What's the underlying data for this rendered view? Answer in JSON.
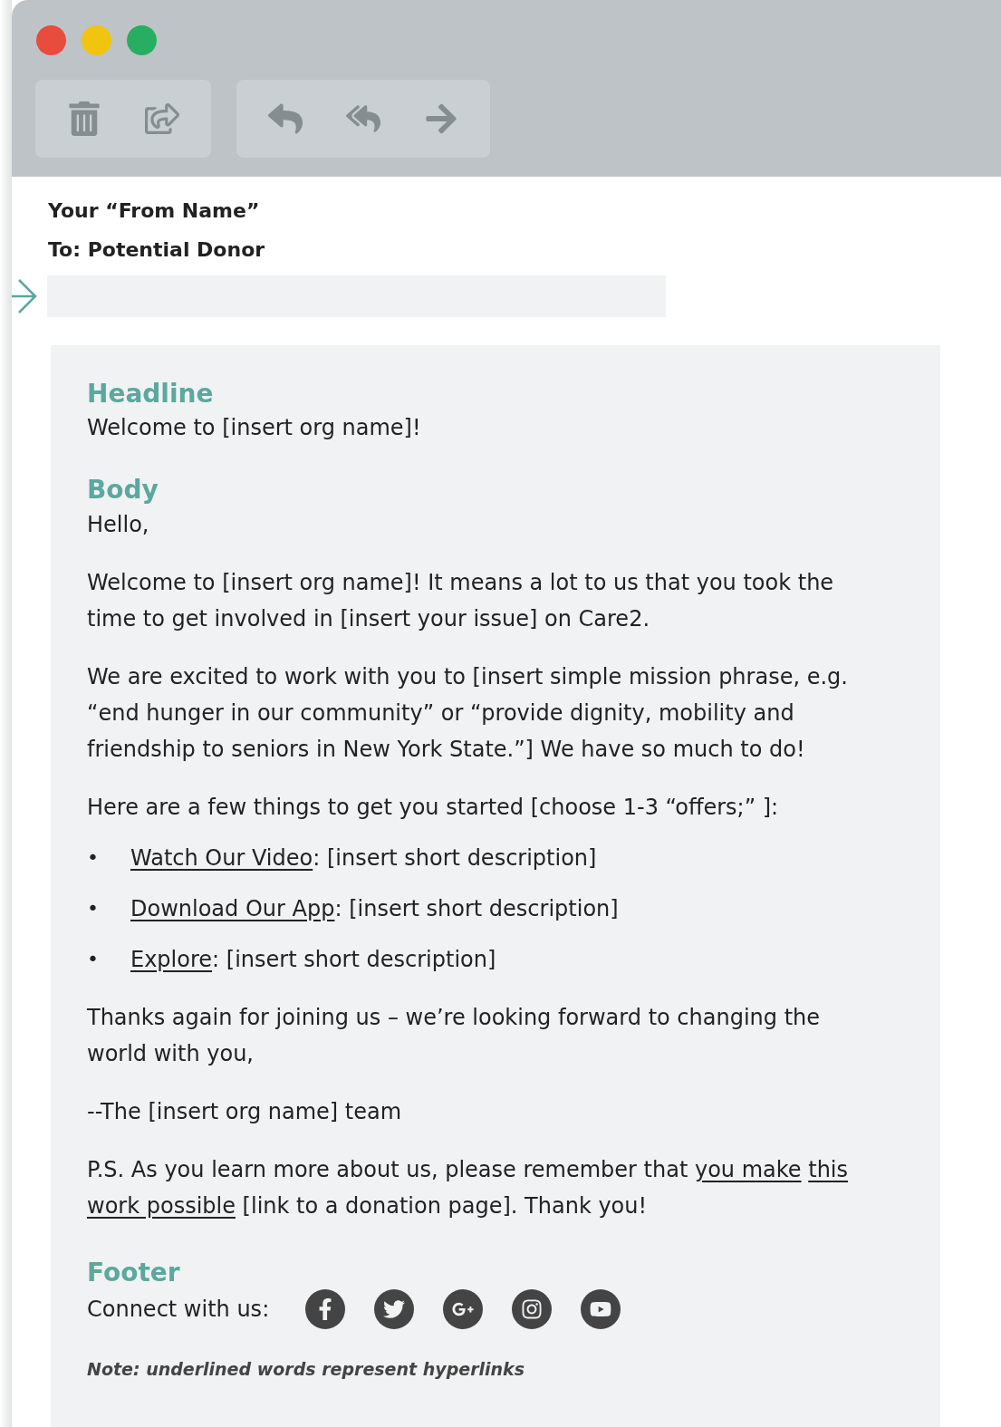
{
  "toolbar": {
    "groups": [
      {
        "buttons": [
          {
            "kind": "trash"
          },
          {
            "kind": "share"
          }
        ]
      },
      {
        "buttons": [
          {
            "kind": "reply"
          },
          {
            "kind": "reply_all"
          },
          {
            "kind": "forward"
          }
        ]
      }
    ]
  },
  "header": {
    "from": "Your “From Name”",
    "to": "To: Potential Donor"
  },
  "headline": {
    "label": "Headline",
    "text": "Welcome to [insert org name]!"
  },
  "body": {
    "label": "Body",
    "blocks": [
      {
        "kind": "paragraph",
        "segments": [
          {
            "text": "Hello,",
            "link": false
          }
        ]
      },
      {
        "kind": "paragraph",
        "segments": [
          {
            "text": "Welcome to [insert org name]! It means a lot to us that you took the time to get involved in [insert your issue] on Care2.",
            "link": false
          }
        ]
      },
      {
        "kind": "paragraph",
        "segments": [
          {
            "text": "We are excited to work with you to [insert simple mission phrase, e.g. “end hunger in our community” or “provide dignity, mobility and friendship to seniors in New York State.”] We have so much to do!",
            "link": false
          }
        ]
      },
      {
        "kind": "paragraph",
        "segments": [
          {
            "text": "Here are a few things to get you started [choose 1-3 “offers;” ]:",
            "link": false
          }
        ]
      },
      {
        "kind": "bullets",
        "bullet": "•",
        "items": [
          {
            "segments": [
              {
                "text": "Watch Our Video",
                "link": true
              },
              {
                "text": ": [insert short description]",
                "link": false
              }
            ]
          },
          {
            "segments": [
              {
                "text": "Download Our App",
                "link": true
              },
              {
                "text": ": [insert short description]",
                "link": false
              }
            ]
          },
          {
            "segments": [
              {
                "text": "Explore",
                "link": true
              },
              {
                "text": ": [insert short description]",
                "link": false
              }
            ]
          }
        ]
      },
      {
        "kind": "paragraph",
        "segments": [
          {
            "text": "Thanks again for joining us – we’re looking forward to changing the world with you,",
            "link": false
          }
        ]
      },
      {
        "kind": "paragraph",
        "segments": [
          {
            "text": "--The [insert org name] team",
            "link": false
          }
        ]
      },
      {
        "kind": "paragraph",
        "segments": [
          {
            "text": "P.S. As you learn more about us, please remember that ",
            "link": false
          },
          {
            "text": "you make",
            "link": true
          },
          {
            "text": "this",
            "link": true
          },
          {
            "text": "work possible",
            "link": true
          },
          {
            "text": " [link to a donation page]. Thank you!",
            "link": false
          }
        ]
      }
    ]
  },
  "footer": {
    "label": "Footer",
    "connect": "Connect with us:",
    "socials": [
      {
        "kind": "facebook"
      },
      {
        "kind": "twitter"
      },
      {
        "kind": "google_plus"
      },
      {
        "kind": "instagram"
      },
      {
        "kind": "youtube"
      }
    ],
    "note": "Note: underlined words represent hyperlinks"
  }
}
